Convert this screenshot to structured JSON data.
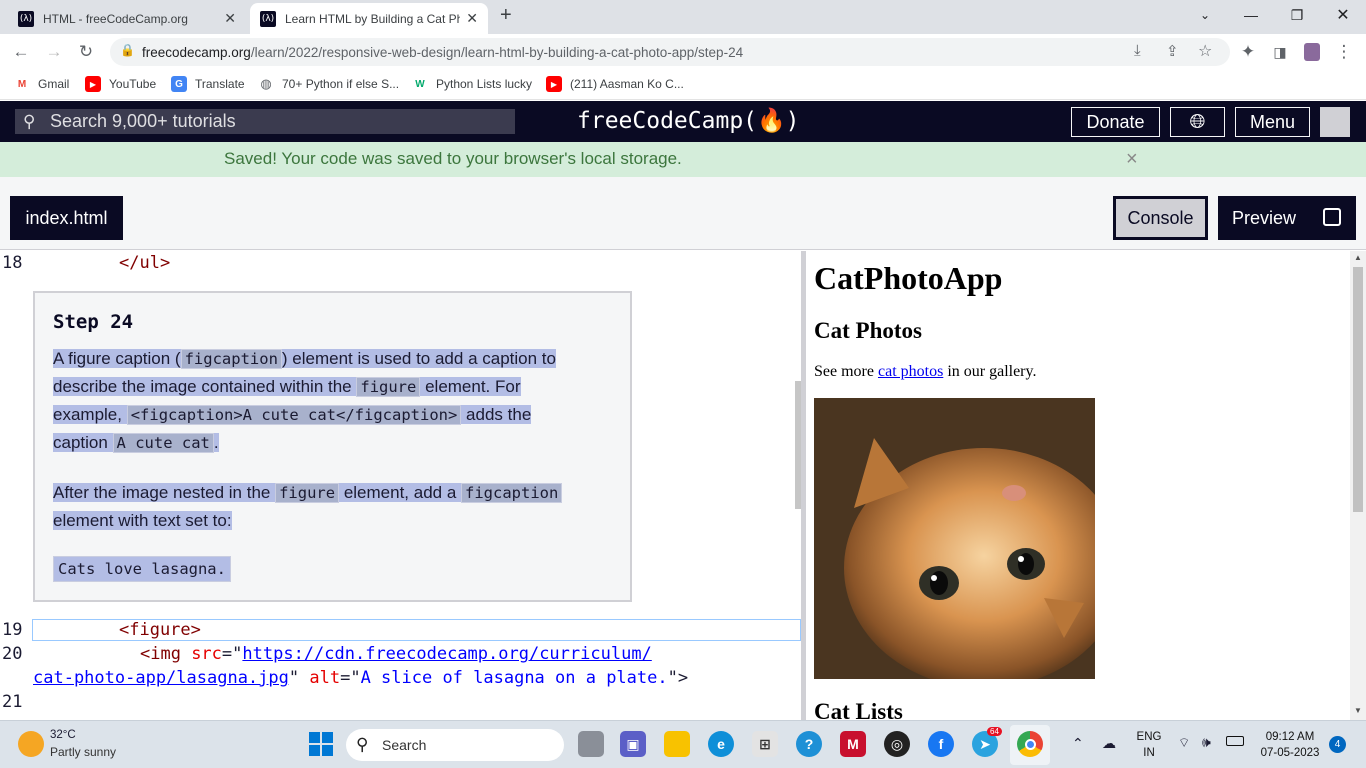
{
  "browser": {
    "tabs": [
      {
        "title": "HTML - freeCodeCamp.org",
        "favicon": "freecodecamp-icon",
        "active": false
      },
      {
        "title": "Learn HTML by Building a Cat Ph",
        "favicon": "freecodecamp-icon",
        "active": true
      }
    ],
    "new_tab": "+",
    "url_domain": "freecodecamp.org",
    "url_path": "/learn/2022/responsive-web-design/learn-html-by-building-a-cat-photo-app/step-24",
    "bookmarks": [
      {
        "label": "Gmail",
        "icon": "gmail-icon"
      },
      {
        "label": "YouTube",
        "icon": "youtube-icon"
      },
      {
        "label": "Translate",
        "icon": "translate-icon"
      },
      {
        "label": "70+ Python if else S...",
        "icon": "globe-icon"
      },
      {
        "label": "Python Lists lucky",
        "icon": "w3schools-icon"
      },
      {
        "label": "(211) Aasman Ko C...",
        "icon": "youtube-icon"
      }
    ]
  },
  "fcc": {
    "search_placeholder": "Search 9,000+ tutorials",
    "logo": "freeCodeCamp(🔥)",
    "donate": "Donate",
    "menu": "Menu",
    "banner": "Saved! Your code was saved to your browser's local storage.",
    "banner_close": "×",
    "file_tab": "index.html",
    "console": "Console",
    "preview": "Preview"
  },
  "editor": {
    "line_numbers": [
      "18",
      "19",
      "20",
      "21"
    ],
    "line18": "</ul>",
    "line19": "<figure>",
    "line20_tag": "<img ",
    "line20_attr1": "src",
    "line20_eq1": "=\"",
    "line20_url1": "https://cdn.freecodecamp.org/curriculum/",
    "line20_url2": "cat-photo-app/lasagna.jpg",
    "line20_q": "\" ",
    "line20_attr2": "alt",
    "line20_eq2": "=\"",
    "line20_alt": "A slice of lasagna on a plate.",
    "line20_end": "\">"
  },
  "step": {
    "title": "Step 24",
    "p1_a": "A figure caption (",
    "p1_code1": "figcaption",
    "p1_b": ") element is used to add a caption to",
    "p1_c": "describe the image contained within the ",
    "p1_code2": "figure",
    "p1_d": " element. For",
    "p1_e": "example, ",
    "p1_code3": "<figcaption>A cute cat</figcaption>",
    "p1_f": " adds the",
    "p1_g": "caption ",
    "p1_code4": "A cute cat",
    "p1_h": ".",
    "p2_a": "After the image nested in the ",
    "p2_code1": "figure",
    "p2_b": " element, add a ",
    "p2_code2": "figcaption",
    "p2_c": "element with text set to:",
    "p3_code": "Cats love lasagna."
  },
  "preview": {
    "h1": "CatPhotoApp",
    "h2": "Cat Photos",
    "p_before": "See more ",
    "p_link": "cat photos",
    "p_after": " in our gallery.",
    "h2b": "Cat Lists"
  },
  "taskbar": {
    "weather_temp": "32°C",
    "weather_desc": "Partly sunny",
    "search": "Search",
    "lang1": "ENG",
    "lang2": "IN",
    "time": "09:12 AM",
    "date": "07-05-2023",
    "notif": "4",
    "telegram_badge": "64"
  },
  "colors": {
    "fcc_dark": "#0a0a23",
    "banner_bg": "#d4edda",
    "highlight": "#b3bde5"
  }
}
